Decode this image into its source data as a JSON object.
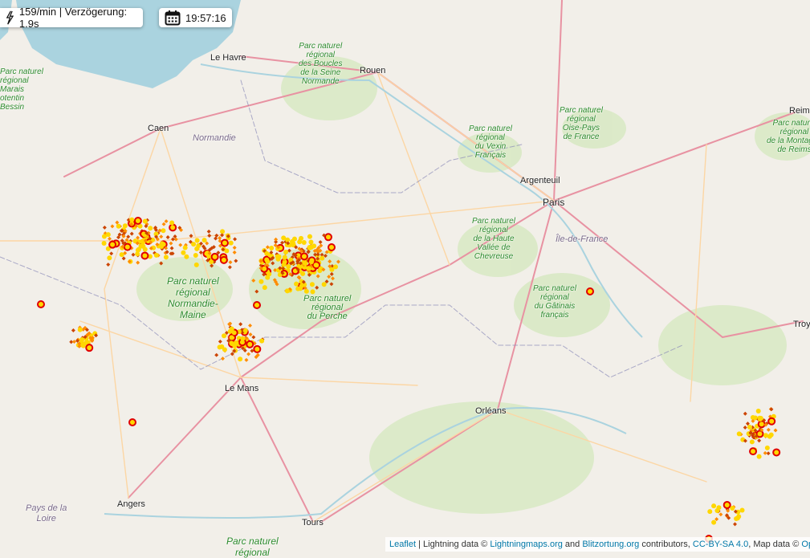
{
  "controls": {
    "rate": "159/min | Verzögerung: 1.9s",
    "time": "19:57:16",
    "bolt_icon": "lightning-bolt-icon",
    "calendar_icon": "calendar-icon"
  },
  "cities": [
    "Le Havre",
    "Rouen",
    "Caen",
    "Paris",
    "Argenteuil",
    "Le Mans",
    "Orléans",
    "Angers",
    "Tours",
    "Reims",
    "Troy"
  ],
  "regions": [
    "Normandie",
    "Île-de-France"
  ],
  "parks": {
    "boucles": "Parc naturel\nrégional\ndes Boucles\nde la Seine\nNormande",
    "vexin": "Parc naturel\nrégional\ndu Vexin\nFrançais",
    "oise": "Parc naturel\nrégional\nOise-Pays\nde France",
    "chevreuse": "Parc naturel\nrégional\nde la Haute\nVallée de\nChevreuse",
    "gatinais": "Parc naturel\nrégional\ndu Gâtinais\nfrançais",
    "reims": "Parc naturel\nrégional\nde la Montagne\nde Reims",
    "marais": "Parc naturel\nrégional\nMarais\notentin\nBessin",
    "normandie_maine": "Parc naturel\nrégional\nNormandie-\nMaine",
    "perche": "Parc naturel\nrégional\ndu Perche",
    "loire": "Pays de la\nLoire",
    "bottom": "Parc naturel\nrégional"
  },
  "attribution": {
    "leaflet": "Leaflet",
    "sep": " | Lightning data © ",
    "lm": "Lightningmaps.org",
    "and": " and ",
    "bo": "Blitzortung.org",
    "contrib": " contributors, ",
    "license": "CC-BY-SA 4.0",
    "mapdata": ", Map data © ",
    "osm": "Ope"
  },
  "colors": {
    "land": "#f2efe9",
    "sea": "#aad3df",
    "forest": "#cde6b5",
    "strike_new": "#ffd700",
    "strike_mid": "#ff8c00",
    "strike_old": "#cc4400",
    "ring": "#e00000"
  }
}
